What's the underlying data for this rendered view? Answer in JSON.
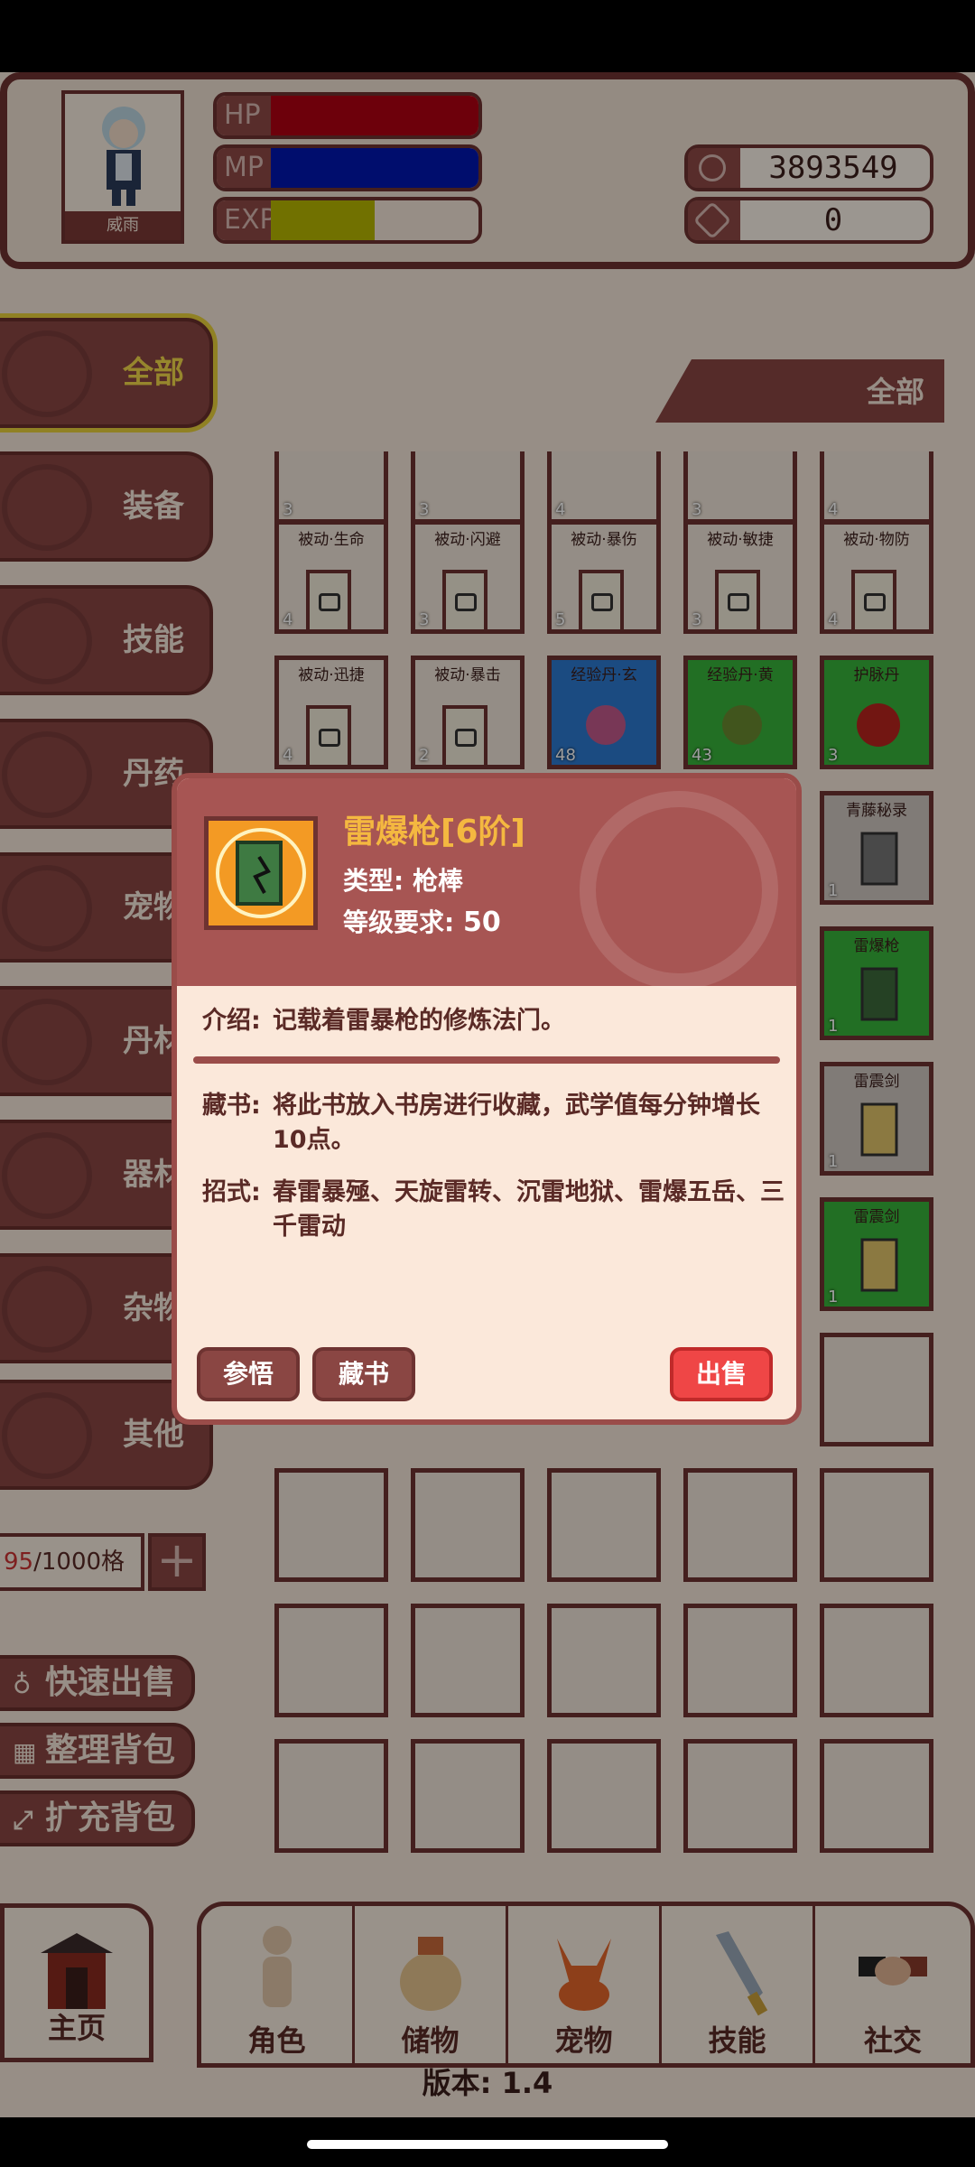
{
  "player": {
    "name": "威雨"
  },
  "stats": {
    "hp": {
      "label": "HP",
      "fill": 1.0,
      "color": "#b00012"
    },
    "mp": {
      "label": "MP",
      "fill": 1.0,
      "color": "#0015b0"
    },
    "exp": {
      "label": "EXP",
      "fill": 0.5,
      "color": "#b6b600"
    }
  },
  "currency": {
    "coins": "3893549",
    "gems": "0"
  },
  "sidebar": {
    "tabs": [
      {
        "label": "全部",
        "active": true
      },
      {
        "label": "装备"
      },
      {
        "label": "技能"
      },
      {
        "label": "丹药"
      },
      {
        "label": "宠物"
      },
      {
        "label": "丹材"
      },
      {
        "label": "器材"
      },
      {
        "label": "杂物"
      },
      {
        "label": "其他"
      }
    ],
    "capacity_used": "95",
    "capacity_total": "/1000格",
    "actions": [
      {
        "label": "快速出售",
        "icon": "money-bag-icon"
      },
      {
        "label": "整理背包",
        "icon": "grid-icon"
      },
      {
        "label": "扩充背包",
        "icon": "expand-icon"
      }
    ]
  },
  "filter": {
    "label": "全部"
  },
  "grid": {
    "row0": [
      {
        "count": "3"
      },
      {
        "count": "3"
      },
      {
        "count": "4"
      },
      {
        "count": "3"
      },
      {
        "count": "4"
      }
    ],
    "row1": [
      {
        "name": "被动·生命",
        "count": "4"
      },
      {
        "name": "被动·闪避",
        "count": "3"
      },
      {
        "name": "被动·暴伤",
        "count": "5"
      },
      {
        "name": "被动·敏捷",
        "count": "3"
      },
      {
        "name": "被动·物防",
        "count": "4"
      }
    ],
    "row2": [
      {
        "name": "被动·迅捷",
        "count": "4"
      },
      {
        "name": "被动·暴击",
        "count": "2"
      },
      {
        "name": "经验丹·玄",
        "count": "48"
      },
      {
        "name": "经验丹·黄",
        "count": "43"
      },
      {
        "name": "护脉丹",
        "count": "3"
      }
    ],
    "right_column": [
      {
        "name": "青藤秘录",
        "count": "1"
      },
      {
        "name": "雷爆枪",
        "count": "1"
      },
      {
        "name": "雷震剑",
        "count": "1"
      },
      {
        "name": "雷震剑",
        "count": "1"
      }
    ]
  },
  "dialog": {
    "title": "雷爆枪[6阶]",
    "type": "类型: 枪棒",
    "level_label": "等级要求: ",
    "level": "50",
    "intro_key": "介绍:",
    "intro_val": "记载着雷暴枪的修炼法门。",
    "library_key": "藏书:",
    "library_val": "将此书放入书房进行收藏，武学值每分钟增长10点。",
    "moves_key": "招式:",
    "moves_val": "春雷暴殛、天旋雷转、沉雷地狱、雷爆五岳、三千雷动",
    "buttons": {
      "comprehend": "参悟",
      "collect": "藏书",
      "sell": "出售"
    }
  },
  "nav": {
    "home": "主页",
    "items": [
      {
        "label": "角色",
        "icon": "character-icon"
      },
      {
        "label": "储物",
        "icon": "bag-icon"
      },
      {
        "label": "宠物",
        "icon": "fox-icon"
      },
      {
        "label": "技能",
        "icon": "sword-icon"
      },
      {
        "label": "社交",
        "icon": "handshake-icon"
      }
    ]
  },
  "version": "版本: 1.4"
}
